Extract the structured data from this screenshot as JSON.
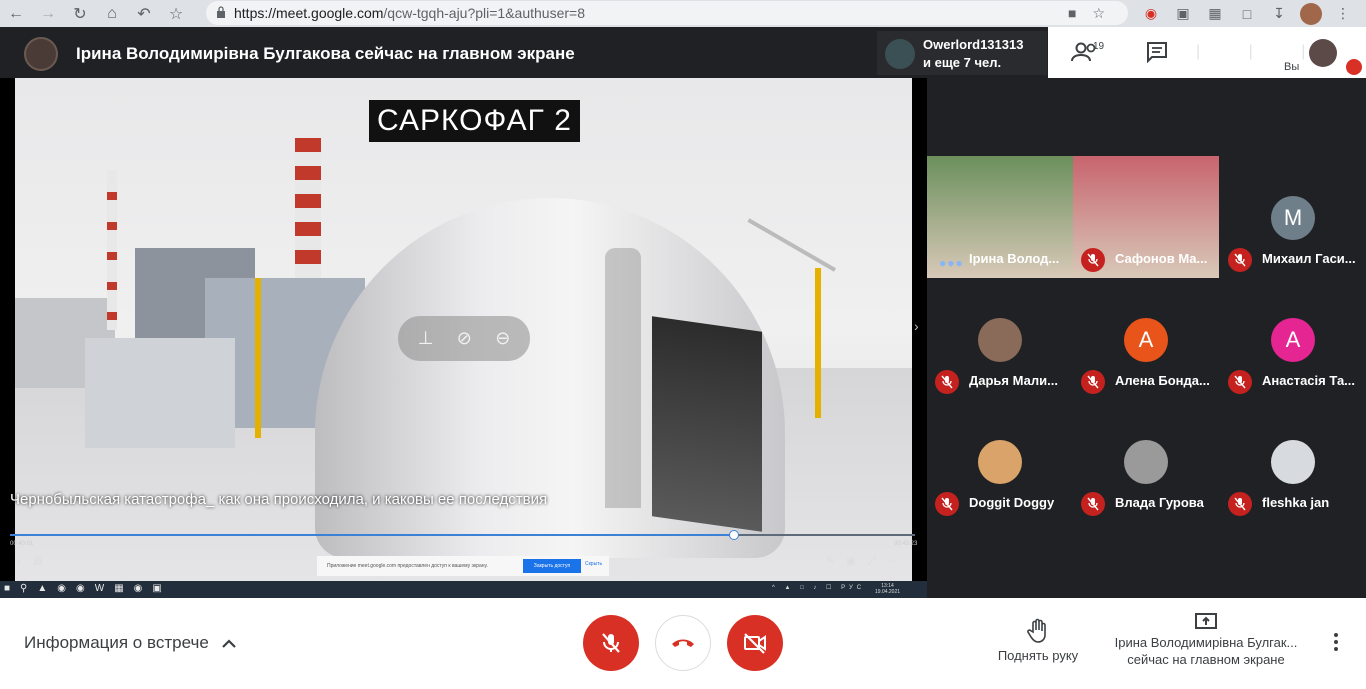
{
  "browser": {
    "url_host": "https://meet.google.com",
    "url_rest": "/qcw-tgqh-aju?pli=1&authuser=8"
  },
  "topbar": {
    "presenter_title": "Ірина Володимирівна Булгакова сейчас на главном экране",
    "other_name": "Owerlord131313",
    "other_more": "и еще 7 чел.",
    "people_count": "19",
    "self_label": "Вы"
  },
  "screen": {
    "video_title": "САРКОФАГ 2",
    "caption": "Чернобыльская катастрофа_ как она происходила, и каковы ее последствия",
    "progress_fraction": 0.8,
    "time_left": "00:40:01",
    "time_right": "00:45:23",
    "share_banner": "Приложение meet.google.com предоставлен доступ к вашему экрану.",
    "share_stop": "Закрыть доступ",
    "share_hide": "Скрыть",
    "clock_time": "13:14",
    "clock_date": "19.04.2021",
    "tray_lang": "РУС"
  },
  "participants": [
    {
      "name": "Ірина Волод...",
      "photo": true,
      "speaking": true,
      "color": "#6b8f5c"
    },
    {
      "name": "Сафонов Ма...",
      "photo": true,
      "muted": true,
      "color": "#c8646e"
    },
    {
      "name": "Михаил Гаси...",
      "initial": "M",
      "muted": true,
      "color": "#6f7f8a"
    },
    {
      "name": "Дарья Мали...",
      "photo_avatar": true,
      "muted": true,
      "color": "#8a6b5a"
    },
    {
      "name": "Алена Бонда...",
      "initial": "A",
      "muted": true,
      "color": "#e8541a"
    },
    {
      "name": "Анастасія Та...",
      "initial": "A",
      "muted": true,
      "color": "#e52592"
    },
    {
      "name": "Doggit Doggy",
      "photo_avatar": true,
      "muted": true,
      "color": "#d9a36a"
    },
    {
      "name": "Влада Гурова",
      "photo_avatar": true,
      "muted": true,
      "color": "#9a9a9a"
    },
    {
      "name": "fleshka jan",
      "photo_avatar": true,
      "muted": true,
      "color": "#d7dbe0"
    }
  ],
  "bottombar": {
    "meeting_info": "Информация о встрече",
    "raise_hand": "Поднять руку",
    "presenting_line1": "Ірина Володимирівна Булгак...",
    "presenting_line2": "сейчас на главном экране"
  },
  "colors": {
    "danger": "#d93025",
    "meet_dark": "#202124",
    "tile_bg": "#3c4043"
  }
}
